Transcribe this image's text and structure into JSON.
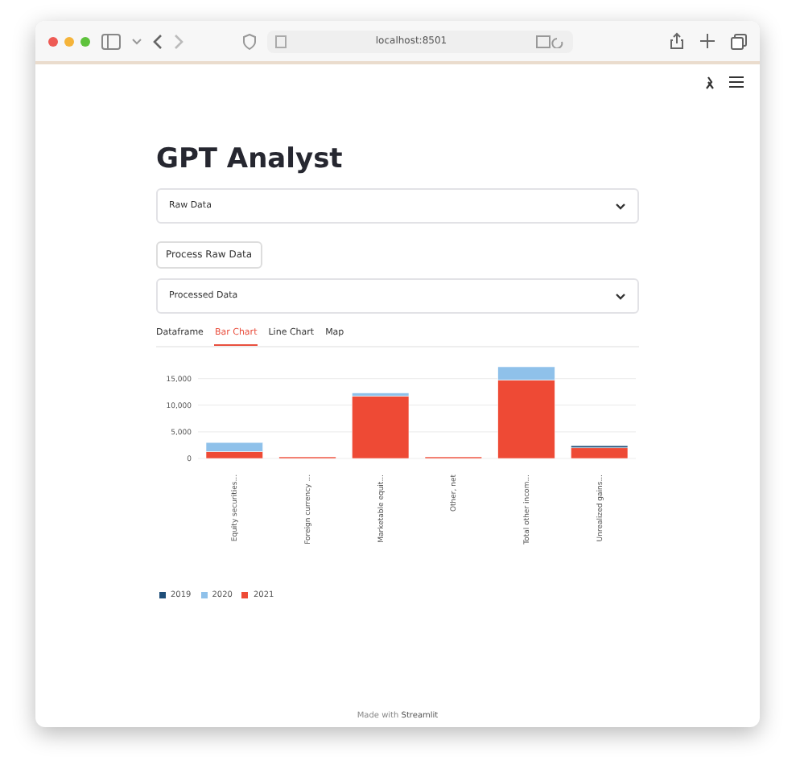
{
  "browser": {
    "address": "localhost:8501"
  },
  "title": "GPT Analyst",
  "selects": [
    {
      "value": "Raw Data"
    }
  ],
  "button": "Process Raw Data",
  "selects2": [
    {
      "value": "Processed Data"
    }
  ],
  "tabs": [
    {
      "label": "Dataframe",
      "selected": false
    },
    {
      "label": "Bar Chart",
      "selected": true
    },
    {
      "label": "Line Chart",
      "selected": false
    },
    {
      "label": "Map",
      "selected": false
    }
  ],
  "chart_data": {
    "type": "bar",
    "stacked": true,
    "ylim": [
      0,
      17500
    ],
    "legend": true,
    "grid": true,
    "categories": [
      "Equity securities...",
      "Foreign currency ...",
      "Marketable equit...",
      "Other, net",
      "Total other incom...",
      "Unrealized gains..."
    ],
    "yticks": [
      {
        "value": 0,
        "label": "0"
      },
      {
        "value": 5000,
        "label": "5,000"
      },
      {
        "value": 10000,
        "label": "10,000"
      },
      {
        "value": 15000,
        "label": "15,000"
      }
    ],
    "series": [
      {
        "name": "2019",
        "color": "#1f4e79",
        "values": [
          0,
          0,
          0,
          0,
          0,
          400
        ]
      },
      {
        "name": "2020",
        "color": "#8fc1ea",
        "values": [
          1700,
          0,
          600,
          0,
          2500,
          0
        ]
      },
      {
        "name": "2021",
        "color": "#ee4a35",
        "values": [
          1300,
          300,
          11700,
          300,
          14700,
          2000
        ]
      }
    ]
  },
  "footer": {
    "prefix": "Made with",
    "brand": "Streamlit"
  }
}
